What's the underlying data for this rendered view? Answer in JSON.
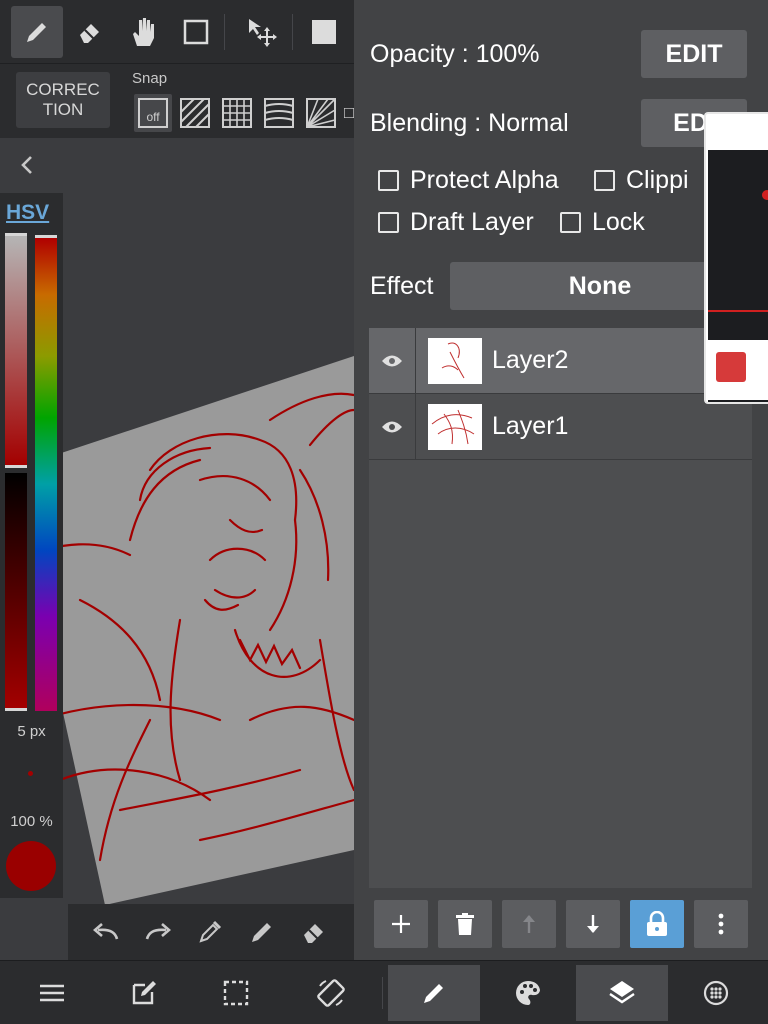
{
  "top_toolbar": {
    "tools": [
      "pen-icon",
      "eraser-icon",
      "hand-icon",
      "rectangle-select-icon",
      "move-transform-icon",
      "color-fill-square-icon"
    ],
    "active_tool": "pen"
  },
  "snap_bar": {
    "correction_label": "CORREC\nTION",
    "snap_label": "Snap",
    "snap_off_label": "off"
  },
  "color_panel": {
    "mode_label": "HSV",
    "brush_size": "5 px",
    "opacity": "100 %",
    "color": "#9a0000"
  },
  "layer_panel": {
    "opacity_label": "Opacity : 100%",
    "blending_label": "Blending : Normal",
    "edit_label": "EDIT",
    "edit_label_2": "EDI",
    "protect_alpha": "Protect Alpha",
    "clipping": "Clippi",
    "draft_layer": "Draft Layer",
    "lock": "Lock",
    "effect_label": "Effect",
    "effect_value": "None",
    "layers": [
      {
        "name": "Layer2",
        "selected": true
      },
      {
        "name": "Layer1",
        "selected": false
      }
    ]
  },
  "colors": {
    "accent_blue": "#5a9fd6",
    "stroke_red": "#a30000",
    "panel_bg": "#424345",
    "toolbar_bg": "#2b2c2e"
  }
}
